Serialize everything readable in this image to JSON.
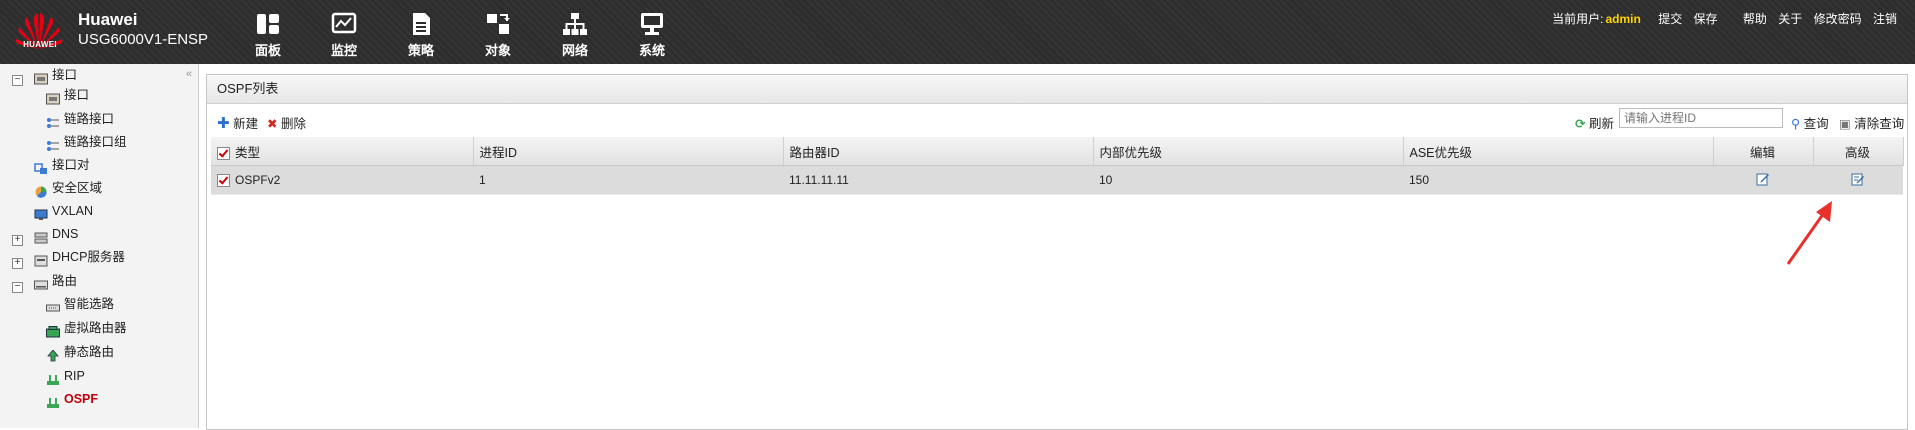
{
  "header": {
    "brand": "Huawei",
    "model": "USG6000V1-ENSP",
    "logo_text": "HUAWEI",
    "nav": [
      {
        "label": "面板",
        "icon": "dashboard-icon"
      },
      {
        "label": "监控",
        "icon": "monitor-icon"
      },
      {
        "label": "策略",
        "icon": "policy-icon"
      },
      {
        "label": "对象",
        "icon": "object-icon"
      },
      {
        "label": "网络",
        "icon": "network-icon"
      },
      {
        "label": "系统",
        "icon": "system-icon"
      }
    ],
    "current_user_label": "当前用户:",
    "username": "admin",
    "links": [
      "提交",
      "保存",
      "帮助",
      "关于",
      "修改密码",
      "注销"
    ]
  },
  "sidebar": {
    "collapse_glyph": "«",
    "items": [
      {
        "label": "接口",
        "expander": "−"
      },
      {
        "label": "接口"
      },
      {
        "label": "链路接口"
      },
      {
        "label": "链路接口组"
      },
      {
        "label": "接口对"
      },
      {
        "label": "安全区域"
      },
      {
        "label": "VXLAN"
      },
      {
        "label": "DNS",
        "expander": "+"
      },
      {
        "label": "DHCP服务器",
        "expander": "+"
      },
      {
        "label": "路由",
        "expander": "−"
      },
      {
        "label": "智能选路"
      },
      {
        "label": "虚拟路由器"
      },
      {
        "label": "静态路由"
      },
      {
        "label": "RIP"
      },
      {
        "label": "OSPF",
        "active": true
      }
    ]
  },
  "main": {
    "title": "OSPF列表",
    "toolbar": {
      "new": "新建",
      "delete": "删除",
      "refresh": "刷新",
      "search_placeholder": "请输入进程ID",
      "query": "查询",
      "clear_query": "清除查询"
    },
    "table": {
      "columns": [
        "类型",
        "进程ID",
        "路由器ID",
        "内部优先级",
        "ASE优先级",
        "编辑",
        "高级"
      ],
      "rows": [
        {
          "type": "OSPFv2",
          "process_id": "1",
          "router_id": "11.11.11.11",
          "internal_priority": "10",
          "ase_priority": "150"
        }
      ]
    }
  },
  "colors": {
    "accent_red": "#c0000a",
    "annotation_arrow": "#e8302a",
    "username": "#ffd200"
  }
}
